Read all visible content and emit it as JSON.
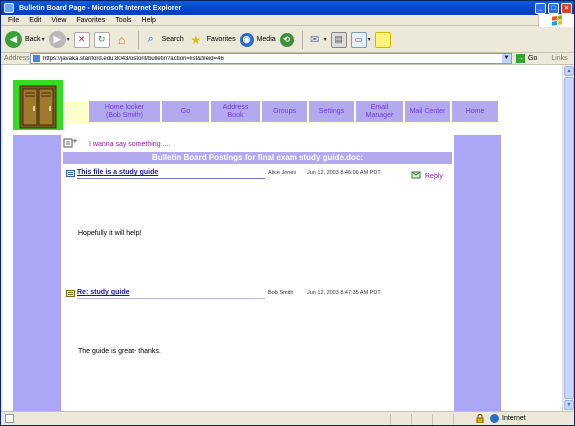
{
  "window": {
    "title": "Bulletin Board Page - Microsoft Internet Explorer"
  },
  "menu": {
    "items": [
      "File",
      "Edit",
      "View",
      "Favorites",
      "Tools",
      "Help"
    ]
  },
  "toolbar": {
    "back_label": "Back",
    "search_label": "Search",
    "favorites_label": "Favorites",
    "media_label": "Media"
  },
  "address": {
    "label": "Address",
    "url": "https://javaka.stanford.edu:8043/ustorit/bulletin?action=list&fileid=46",
    "go_label": "Go",
    "links_label": "Links"
  },
  "nav": {
    "items": [
      {
        "line1": "Home locker",
        "line2": "(Bob Smith)"
      },
      {
        "line1": "Go",
        "line2": ""
      },
      {
        "line1": "Address",
        "line2": "Book"
      },
      {
        "line1": "Groups",
        "line2": ""
      },
      {
        "line1": "Settings",
        "line2": ""
      },
      {
        "line1": "Email",
        "line2": "Manager"
      },
      {
        "line1": "Mail Center",
        "line2": ""
      },
      {
        "line1": "Home",
        "line2": ""
      }
    ]
  },
  "board": {
    "compose_label": "I wanna say something ....",
    "title": "Bulletin Board Postings for final exam study guide.doc:",
    "reply_label": "Reply",
    "posts": [
      {
        "title": "This file is a study guide",
        "author": "Alice Jones",
        "date": "Jun 12, 2003 8:46:06 AM PDT",
        "body": "Hopefully it will help!"
      },
      {
        "title": "Re: study guide",
        "author": "Bob Smith",
        "date": "Jun 12, 2003 8:47:35 AM PDT",
        "body": "The guide is great- thanks."
      }
    ]
  },
  "status": {
    "zone_label": "Internet"
  },
  "colors": {
    "nav_bg": "#b3a9ef",
    "nav_text": "#6e3ad8",
    "side_col": "#aba6f5",
    "accent_purple": "#8b1fa0",
    "logo_bg": "#33dd22"
  }
}
